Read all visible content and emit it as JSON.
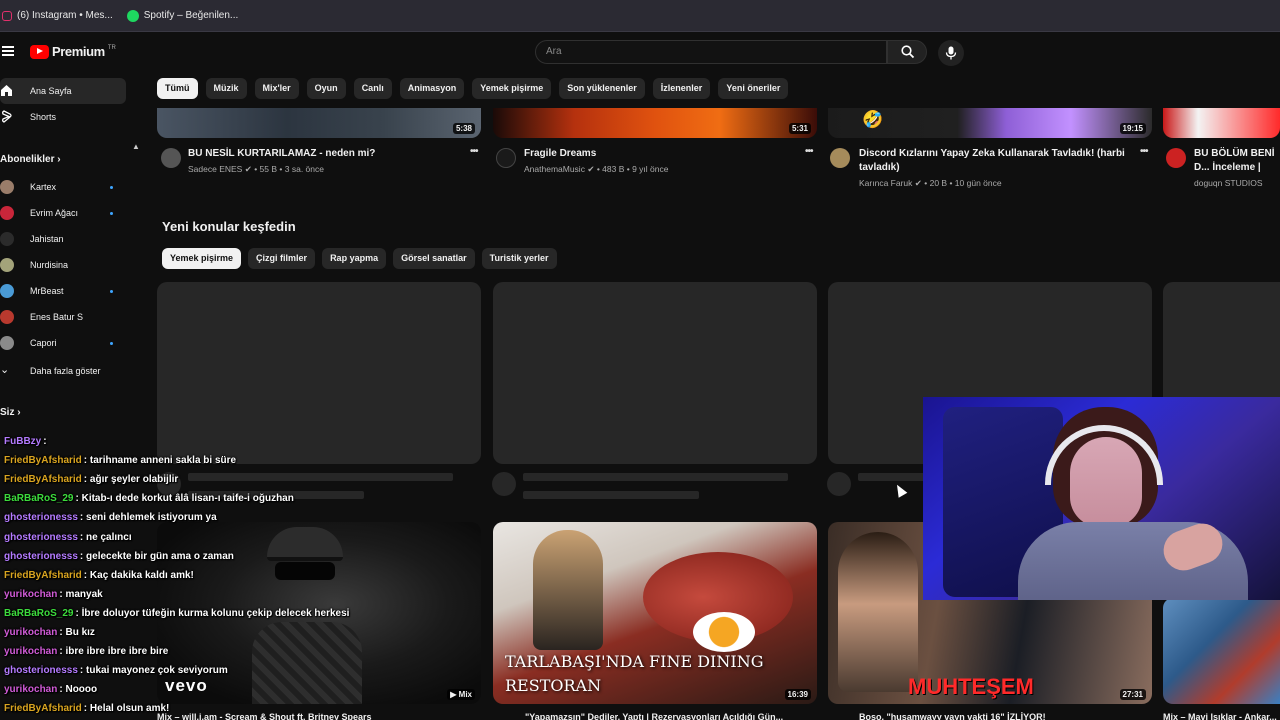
{
  "browser": {
    "bookmarks": [
      {
        "label": "(6) Instagram • Mes...",
        "icon": "instagram-icon"
      },
      {
        "label": "Spotify – Beğenilen...",
        "icon": "spotify-icon"
      }
    ]
  },
  "masthead": {
    "logo_text": "Premium",
    "logo_region": "TR",
    "search_placeholder": "Ara"
  },
  "sidebar": {
    "main": [
      {
        "label": "Ana Sayfa",
        "icon": "home-icon",
        "active": true
      },
      {
        "label": "Shorts",
        "icon": "shorts-icon"
      }
    ],
    "subscriptions_title": "Abonelikler",
    "subscriptions": [
      {
        "label": "Kartex",
        "new": true
      },
      {
        "label": "Evrim Ağacı",
        "new": true
      },
      {
        "label": "Jahistan",
        "new": false
      },
      {
        "label": "Nurdisina",
        "new": false
      },
      {
        "label": "MrBeast",
        "new": true
      },
      {
        "label": "Enes Batur S",
        "new": false
      },
      {
        "label": "Capori",
        "new": true
      }
    ],
    "show_more": "Daha fazla göster",
    "you_title": "Siz"
  },
  "chips": [
    "Tümü",
    "Müzik",
    "Mix'ler",
    "Oyun",
    "Canlı",
    "Animasyon",
    "Yemek pişirme",
    "Son yüklenenler",
    "İzlenenler",
    "Yeni öneriler"
  ],
  "videos_top": [
    {
      "title": "BU NESİL KURTARILAMAZ - neden mi?",
      "channel": "Sadece ENES",
      "views": "55 B",
      "age": "3 sa. önce",
      "duration": "5:38"
    },
    {
      "title": "Fragile Dreams",
      "channel": "AnathemaMusic",
      "views": "483 B",
      "age": "9 yıl önce",
      "duration": "5:31"
    },
    {
      "title": "Discord Kızlarını Yapay Zeka Kullanarak Tavladık! (harbi tavladık)",
      "channel": "Karınca Faruk",
      "views": "20 B",
      "age": "10 gün önce",
      "duration": "19:15"
    },
    {
      "title": "BU BÖLÜM BENİ D... İnceleme | Soldier",
      "channel": "doguqn STUDIOS"
    }
  ],
  "explore": {
    "title": "Yeni konular keşfedin",
    "chips": [
      "Yemek pişirme",
      "Çizgi filmler",
      "Rap yapma",
      "Görsel sanatlar",
      "Turistik yerler"
    ]
  },
  "videos_bottom": [
    {
      "title": "Mix – will.i.am - Scream & Shout ft. Britney Spears",
      "badge": "Mix",
      "overlay": "vevo"
    },
    {
      "title": "\"Yapamazsın\" Dediler, Yaptı | Rezervasyonları Açıldığı Gün...",
      "overlay": "TARLABAŞI'NDA FINE DINING RESTORAN",
      "duration": "16:39"
    },
    {
      "title": "Boso, \"husamwayy vayn vakti 16\" İZLİYOR!",
      "overlay": "MUHTEŞEM",
      "duration": "27:31"
    },
    {
      "title": "Mix – Mavi Işıklar - Ankar..."
    }
  ],
  "chat": [
    {
      "user": "FuBBzy",
      "msg": ":",
      "color": "#b47bff"
    },
    {
      "user": "FriedByAfsharid",
      "msg": ": tarihname anneni sakla bi süre",
      "color": "#daa520"
    },
    {
      "user": "FriedByAfsharid",
      "msg": ": ağır şeyler olabijlir",
      "color": "#daa520"
    },
    {
      "user": "BaRBaRoS_29",
      "msg": ": Kitab-ı dede korkut âlâ lisan-ı taife-i oğuzhan",
      "color": "#3ddc3d"
    },
    {
      "user": "ghosterionesss",
      "msg": ": seni dehlemek istiyorum ya",
      "color": "#b47bff"
    },
    {
      "user": "ghosterionesss",
      "msg": ": ne çalıncı",
      "color": "#b47bff"
    },
    {
      "user": "ghosterionesss",
      "msg": ": gelecekte bir gün ama o zaman",
      "color": "#b47bff"
    },
    {
      "user": "FriedByAfsharid",
      "msg": ": Kaç dakika kaldı amk!",
      "color": "#daa520"
    },
    {
      "user": "yurikochan",
      "msg": ": manyak",
      "color": "#d05bd6"
    },
    {
      "user": "BaRBaRoS_29",
      "msg": ": İbre doluyor tüfeğin kurma kolunu çekip delecek herkesi",
      "color": "#3ddc3d"
    },
    {
      "user": "yurikochan",
      "msg": ": Bu kız",
      "color": "#d05bd6"
    },
    {
      "user": "yurikochan",
      "msg": ": ibre ibre ibre ibre bire",
      "color": "#d05bd6"
    },
    {
      "user": "ghosterionesss",
      "msg": ": tukai mayonez çok seviyorum",
      "color": "#b47bff"
    },
    {
      "user": "yurikochan",
      "msg": ": Noooo",
      "color": "#d05bd6"
    },
    {
      "user": "FriedByAfsharid",
      "msg": ": Helal olsun amk!",
      "color": "#daa520"
    }
  ],
  "colors": {
    "accent": "#ff0000",
    "bg": "#0f0f0f",
    "chip": "#272727",
    "verified": "#aaaaaa",
    "new_dot": "#3ea6ff"
  }
}
